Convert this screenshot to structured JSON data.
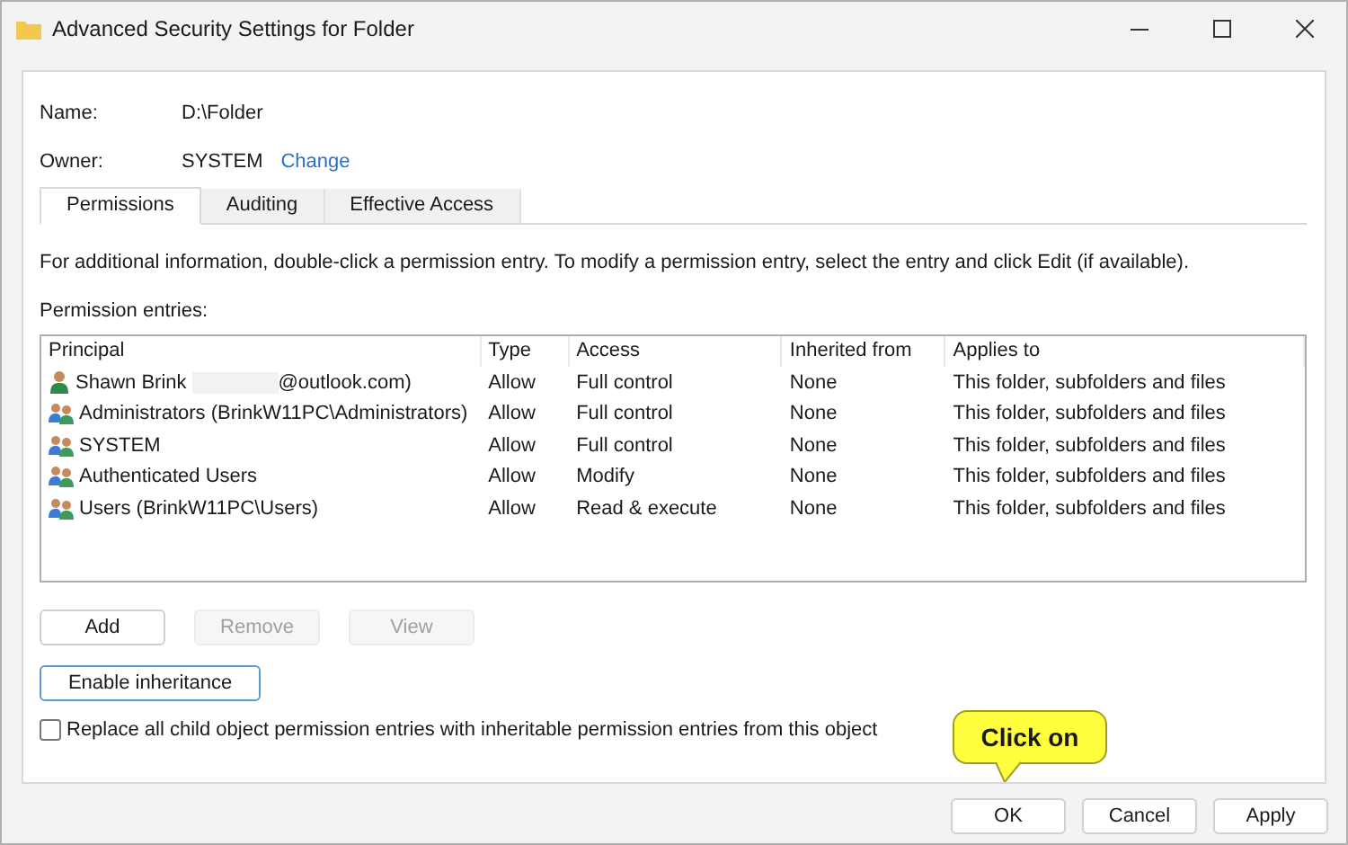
{
  "window": {
    "title": "Advanced Security Settings for Folder"
  },
  "name": {
    "label": "Name:",
    "value": "D:\\Folder"
  },
  "owner": {
    "label": "Owner:",
    "value": "SYSTEM",
    "link": "Change"
  },
  "tabs": [
    {
      "label": "Permissions",
      "selected": true
    },
    {
      "label": "Auditing",
      "selected": false
    },
    {
      "label": "Effective Access",
      "selected": false
    }
  ],
  "info": "For additional information, double-click a permission entry. To modify a permission entry, select the entry and click Edit (if available).",
  "entries_label": "Permission entries:",
  "table": {
    "columns": [
      "Principal",
      "Type",
      "Access",
      "Inherited from",
      "Applies to"
    ],
    "rows": [
      {
        "kind": "user",
        "principal": "Shawn Brink",
        "redacted": true,
        "principal_suffix": "@outlook.com)",
        "type": "Allow",
        "access": "Full control",
        "inherited_from": "None",
        "applies_to": "This folder, subfolders and files"
      },
      {
        "kind": "group",
        "principal": "Administrators (BrinkW11PC\\Administrators)",
        "redacted": false,
        "type": "Allow",
        "access": "Full control",
        "inherited_from": "None",
        "applies_to": "This folder, subfolders and files"
      },
      {
        "kind": "group",
        "principal": "SYSTEM",
        "redacted": false,
        "type": "Allow",
        "access": "Full control",
        "inherited_from": "None",
        "applies_to": "This folder, subfolders and files"
      },
      {
        "kind": "group",
        "principal": "Authenticated Users",
        "redacted": false,
        "type": "Allow",
        "access": "Modify",
        "inherited_from": "None",
        "applies_to": "This folder, subfolders and files"
      },
      {
        "kind": "group",
        "principal": "Users (BrinkW11PC\\Users)",
        "redacted": false,
        "type": "Allow",
        "access": "Read & execute",
        "inherited_from": "None",
        "applies_to": "This folder, subfolders and files"
      }
    ]
  },
  "entry_buttons": [
    {
      "label": "Add",
      "disabled": false
    },
    {
      "label": "Remove",
      "disabled": true
    },
    {
      "label": "View",
      "disabled": true
    }
  ],
  "inheritance_button": {
    "label": "Enable inheritance"
  },
  "replace_checkbox": {
    "label": "Replace all child object permission entries with inheritable permission entries from this object",
    "checked": false
  },
  "callout": "Click on",
  "dialog_buttons": [
    {
      "label": "OK",
      "disabled": false
    },
    {
      "label": "Cancel",
      "disabled": false
    },
    {
      "label": "Apply",
      "disabled": false
    }
  ]
}
